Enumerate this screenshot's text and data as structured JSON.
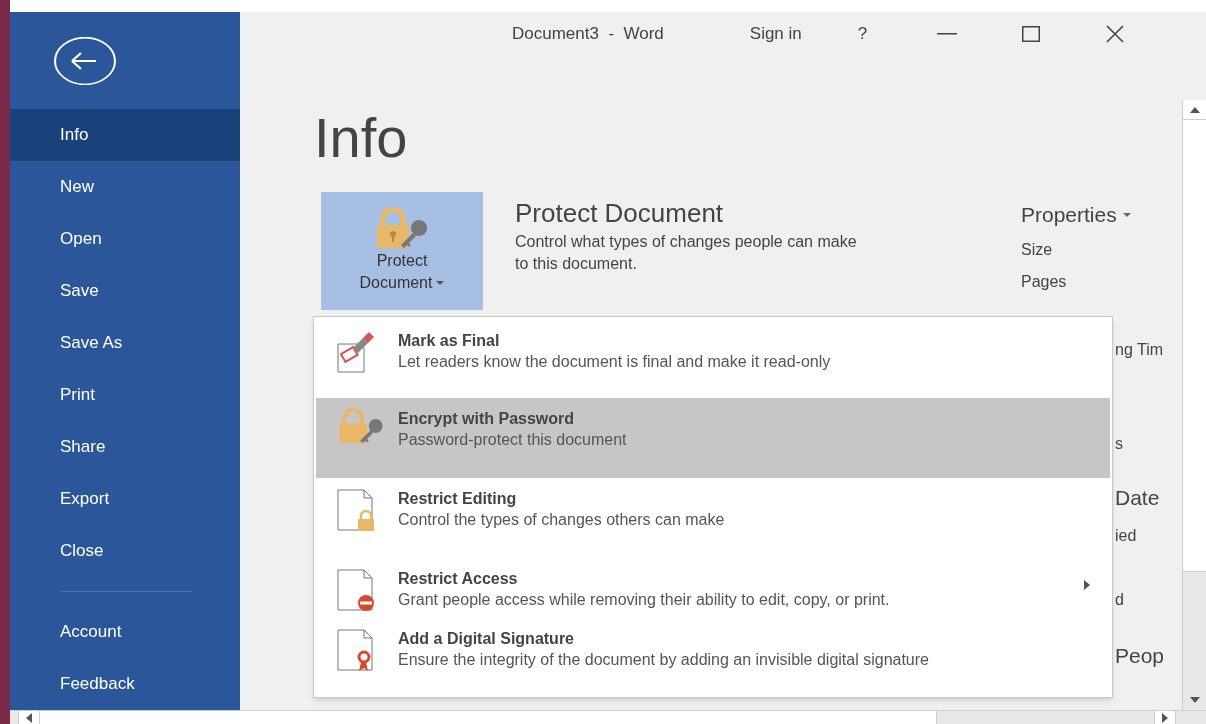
{
  "window": {
    "title": "Document3  -  Word",
    "sign_in": "Sign in",
    "help": "?"
  },
  "sidebar": {
    "items": [
      {
        "label": "Info",
        "selected": true
      },
      {
        "label": "New",
        "selected": false
      },
      {
        "label": "Open",
        "selected": false
      },
      {
        "label": "Save",
        "selected": false
      },
      {
        "label": "Save As",
        "selected": false
      },
      {
        "label": "Print",
        "selected": false
      },
      {
        "label": "Share",
        "selected": false
      },
      {
        "label": "Export",
        "selected": false
      },
      {
        "label": "Close",
        "selected": false
      }
    ],
    "bottom_items": [
      {
        "label": "Account",
        "selected": false
      },
      {
        "label": "Feedback",
        "selected": false
      }
    ]
  },
  "page_title": "Info",
  "protect": {
    "button_line1": "Protect",
    "button_line2": "Document",
    "heading": "Protect Document",
    "description": "Control what types of changes people can make to this document."
  },
  "properties": {
    "heading": "Properties",
    "items": [
      "Size",
      "Pages"
    ],
    "partial_items": [
      "ng Tim",
      "s",
      "Date",
      "ied",
      "d",
      "Peop"
    ]
  },
  "menu": {
    "items": [
      {
        "kind": "final",
        "title": "Mark as Final",
        "description": "Let readers know the document is final and make it read-only",
        "selected": false,
        "submenu": false
      },
      {
        "kind": "encrypt",
        "title": "Encrypt with Password",
        "description": "Password-protect this document",
        "selected": true,
        "submenu": false
      },
      {
        "kind": "editing",
        "title": "Restrict Editing",
        "description": "Control the types of changes others can make",
        "selected": false,
        "submenu": false
      },
      {
        "kind": "access",
        "title": "Restrict Access",
        "description": "Grant people access while removing their ability to edit, copy, or print.",
        "selected": false,
        "submenu": true
      },
      {
        "kind": "signature",
        "title": "Add a Digital Signature",
        "description": "Ensure the integrity of the document by adding an invisible digital signature",
        "selected": false,
        "submenu": false
      }
    ]
  }
}
